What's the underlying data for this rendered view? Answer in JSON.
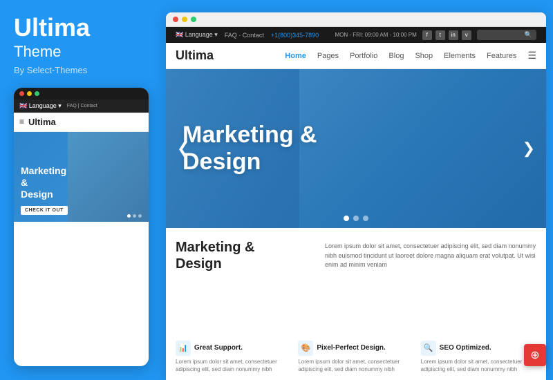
{
  "left": {
    "title": "Ultima",
    "subtitle": "Theme",
    "byline": "By Select-Themes",
    "mobile": {
      "dots": [
        "#e74c3c",
        "#f1c40f",
        "#2ecc71"
      ],
      "topbar_links": "FAQ | Contact",
      "language": "Language",
      "nav_brand": "Ultima",
      "hero_title": "Marketing & Design",
      "hero_btn": "CHECK IT OUT",
      "hero_dots": [
        {
          "active": true
        },
        {
          "active": false
        },
        {
          "active": false
        }
      ]
    }
  },
  "right": {
    "browser_dots": [
      "#e74c3c",
      "#f1c40f",
      "#2ecc71"
    ],
    "topbar": {
      "language": "Language",
      "links": "FAQ · Contact",
      "phone": "+1(800)345-7890",
      "hours": "MON - FRI: 09:00 AM - 10:00 PM"
    },
    "nav": {
      "brand": "Ultima",
      "links": [
        "Home",
        "Pages",
        "Portfolio",
        "Blog",
        "Shop",
        "Elements",
        "Features"
      ],
      "active": "Home"
    },
    "hero": {
      "title_line1": "Marketing &",
      "title_line2": "Design",
      "dots": [
        {
          "active": true
        },
        {
          "active": false
        },
        {
          "active": false
        }
      ]
    },
    "content": {
      "title_line1": "Marketing &",
      "title_line2": "Design",
      "body": "Lorem ipsum dolor sit amet, consectetuer adipiscing elit, sed diam nonummy nibh euismod tincidunt ut laoreet dolore magna aliquam erat volutpat. Ut wisi enim ad minim veniam"
    },
    "features": [
      {
        "icon": "📊",
        "title": "Great Support.",
        "text": "Lorem ipsum dolor sit amet, consectetuer adipiscing elit, sed diam nonummy nibh"
      },
      {
        "icon": "🎨",
        "title": "Pixel-Perfect Design.",
        "text": "Lorem ipsum dolor sit amet, consectetuer adipiscing elit, sed diam nonummy nibh"
      },
      {
        "icon": "🔍",
        "title": "SEO Optimized.",
        "text": "Lorem ipsum dolor sit amet, consectetuer adipiscing elit, sed diam nonummy nibh"
      }
    ]
  }
}
